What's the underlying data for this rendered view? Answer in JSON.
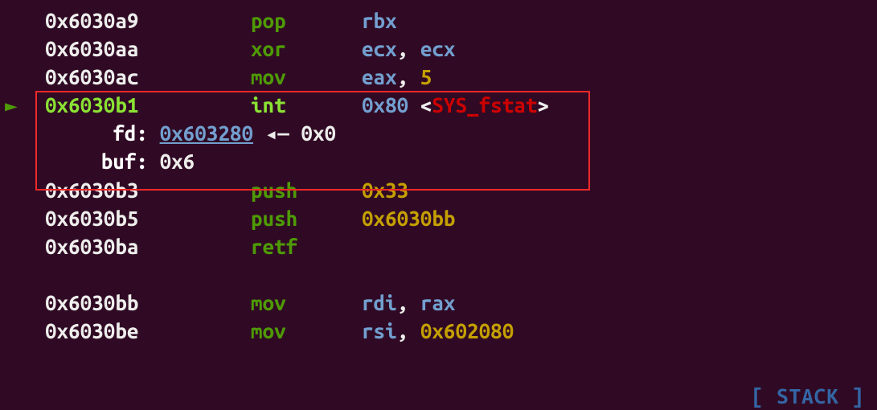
{
  "lines": [
    {
      "addr": "0x6030a9",
      "mn": "pop",
      "op1": "rbx"
    },
    {
      "addr": "0x6030aa",
      "mn": "xor",
      "op1": "ecx",
      "comma": ", ",
      "op2": "ecx"
    },
    {
      "addr": "0x6030ac",
      "mn": "mov",
      "op1": "eax",
      "comma": ", ",
      "op2_num": "5"
    }
  ],
  "current": {
    "marker": "►",
    "addr": "0x6030b1",
    "mn": "int",
    "op1": "0x80",
    "angle_open": " <",
    "sys": "SYS_fstat",
    "angle_close": ">"
  },
  "params": {
    "fd_label": "fd:",
    "fd_link": "0x603280",
    "fd_arrow": " ◂— ",
    "fd_val": "0x0",
    "buf_label": "buf:",
    "buf_val": "0x6"
  },
  "after": [
    {
      "addr": "0x6030b3",
      "mn": "push",
      "op1_num": "0x33"
    },
    {
      "addr": "0x6030b5",
      "mn": "push",
      "op1_num": "0x6030bb"
    },
    {
      "addr": "0x6030ba",
      "mn": "retf",
      "op_blank": " "
    }
  ],
  "blank": " ",
  "after2": [
    {
      "addr": "0x6030bb",
      "mn": "mov",
      "op1": "rdi",
      "comma": ", ",
      "op2": "rax"
    },
    {
      "addr": "0x6030be",
      "mn": "mov",
      "op1": "rsi",
      "comma": ", ",
      "op2_num": "0x602080"
    }
  ],
  "banner": "[ STACK ]"
}
